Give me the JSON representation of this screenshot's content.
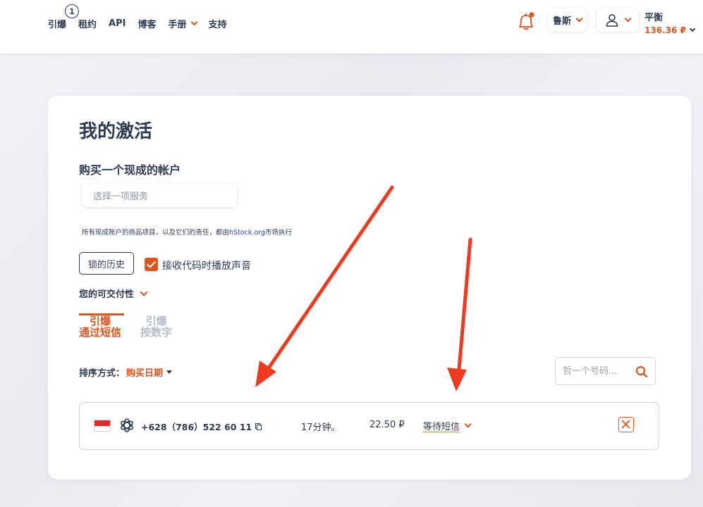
{
  "nav": {
    "items": [
      "引爆",
      "租约",
      "API",
      "博客",
      "手册",
      "支持"
    ],
    "badge_count": "1"
  },
  "header": {
    "language": "鲁斯",
    "balance_label": "平衡",
    "balance_value": "136.36 ₽"
  },
  "main": {
    "title": "我的激活",
    "buy_section_title": "购买一个现成的帐户",
    "service_placeholder": "选择一项服务",
    "notice_prefix": "所有现成账户的商品项目，以及它们的责任，都由",
    "notice_link": "hStock.org",
    "notice_suffix": "市场执行",
    "history_button": "锁的历史",
    "sound_checkbox_label": "接收代码时播放声音",
    "availability_label": "您的可交付性",
    "tabs": [
      {
        "line1": "引爆",
        "line2": "通过短信"
      },
      {
        "line1": "引爆",
        "line2": "按数字"
      }
    ],
    "sort_label": "排序方式：",
    "sort_value": "购买日期",
    "search_placeholder": "哲一个号码..."
  },
  "activation": {
    "phone": "+628（786）522 60 11",
    "time": "17分钟。",
    "price": "22.50 ₽",
    "status": "等待短信"
  },
  "colors": {
    "accent": "#e0541a",
    "text": "#2d3b55",
    "annotation_arrow": "#f03a1f"
  }
}
